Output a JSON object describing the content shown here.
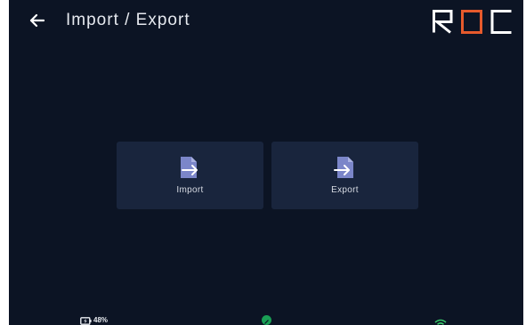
{
  "header": {
    "title": "Import / Export",
    "back_icon": "arrow-left-icon",
    "logo_text": "ROC",
    "colors": {
      "logo_main": "#ffffff",
      "logo_accent": "#e65a2c"
    }
  },
  "actions": [
    {
      "label": "Import",
      "icon": "file-import-icon"
    },
    {
      "label": "Export",
      "icon": "file-export-icon"
    }
  ],
  "status": {
    "battery_text": "48%",
    "battery_icon": "battery-charging-icon",
    "sync_icon": "sync-status-icon",
    "wifi_icon": "wifi-icon",
    "colors": {
      "sync": "#1a9f55",
      "wifi": "#37c96b"
    }
  },
  "colors": {
    "background": "#0c1424",
    "tile": "#19253d",
    "icon_fill": "#7b86c9"
  }
}
